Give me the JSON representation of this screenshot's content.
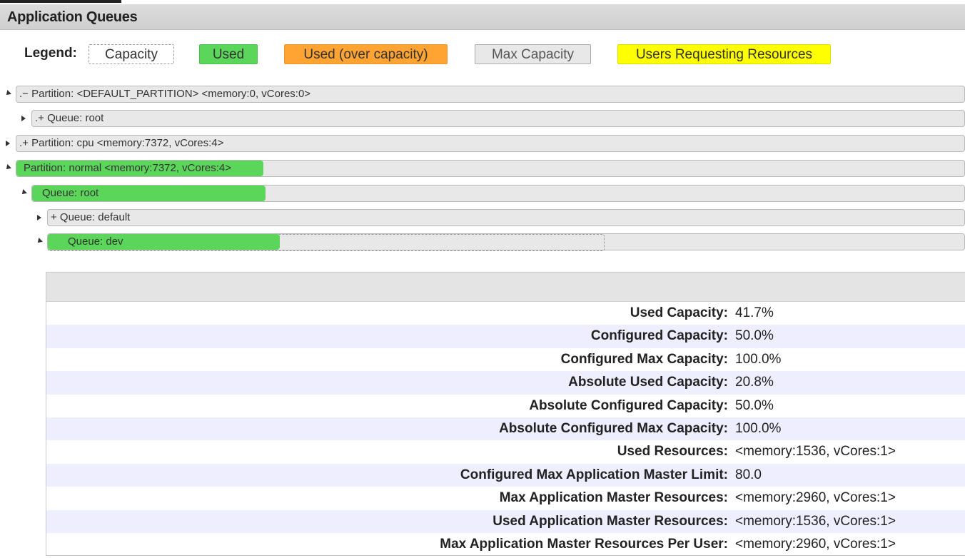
{
  "header": {
    "title": "Application Queues"
  },
  "legend": {
    "title": "Legend:",
    "items": {
      "capacity": "Capacity",
      "used": "Used",
      "over": "Used (over capacity)",
      "max": "Max Capacity",
      "requesting": "Users Requesting Resources"
    }
  },
  "tree": {
    "default_partition": {
      "label": ".− Partition: <DEFAULT_PARTITION> <memory:0, vCores:0>",
      "expanded": true
    },
    "default_root": {
      "label": ".+ Queue: root",
      "expanded": false
    },
    "cpu_partition": {
      "label": ".+ Partition: cpu <memory:7372, vCores:4>",
      "expanded": false
    },
    "normal_partition": {
      "label": "Partition: normal <memory:7372, vCores:4>",
      "expanded": true,
      "used_fraction": 0.26
    },
    "normal_root": {
      "label": "Queue: root",
      "expanded": true,
      "used_fraction": 0.25
    },
    "default_queue": {
      "label": "+ Queue: default",
      "expanded": false
    },
    "dev_queue": {
      "label": "Queue: dev",
      "expanded": true,
      "used_fraction": 0.417
    }
  },
  "details": {
    "rows": [
      {
        "label": "Used Capacity:",
        "value": "41.7%"
      },
      {
        "label": "Configured Capacity:",
        "value": "50.0%"
      },
      {
        "label": "Configured Max Capacity:",
        "value": "100.0%"
      },
      {
        "label": "Absolute Used Capacity:",
        "value": "20.8%"
      },
      {
        "label": "Absolute Configured Capacity:",
        "value": "50.0%"
      },
      {
        "label": "Absolute Configured Max Capacity:",
        "value": "100.0%"
      },
      {
        "label": "Used Resources:",
        "value": "<memory:1536, vCores:1>"
      },
      {
        "label": "Configured Max Application Master Limit:",
        "value": "80.0"
      },
      {
        "label": "Max Application Master Resources:",
        "value": "<memory:2960, vCores:1>"
      },
      {
        "label": "Used Application Master Resources:",
        "value": "<memory:1536, vCores:1>"
      },
      {
        "label": "Max Application Master Resources Per User:",
        "value": "<memory:2960, vCores:1>"
      }
    ]
  },
  "colors": {
    "used": "#5bd65b",
    "over": "#ffa333",
    "max": "#e8e8e8",
    "requesting": "#ffff00",
    "alt_row": "#eeeeff"
  }
}
